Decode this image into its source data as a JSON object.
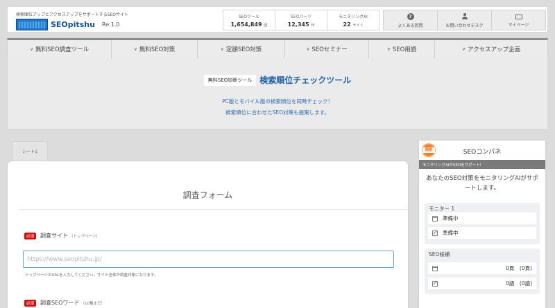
{
  "header": {
    "tagline": "検索順位アップとアクセスアップをサポートするSEOサイト",
    "logo_text": "SEOpitshu",
    "version": "Re:1.0",
    "stats": [
      {
        "label": "SEOツール",
        "value": "1,654,849",
        "unit": "回"
      },
      {
        "label": "SEOパーツ",
        "value": "12,345",
        "unit": "作"
      },
      {
        "label": "モニタリングAI",
        "value": "22",
        "unit": "サイト"
      }
    ],
    "buttons": [
      {
        "icon": "question-icon",
        "label": "よくある質問"
      },
      {
        "icon": "user-icon",
        "label": "お問い合わせデスク"
      },
      {
        "icon": "card-icon",
        "label": "マイページ"
      }
    ]
  },
  "nav": {
    "items": [
      "無料SEO調査ツール",
      "無料SEO対策",
      "定額SEO対策",
      "SEOセミナー",
      "SEO用語",
      "アクセスアップ企画"
    ]
  },
  "hero": {
    "badge": "無料SEO診断ツール",
    "title": "検索順位チェックツール",
    "desc1": "PC版とモバイル版の検索順位を同時チェック！",
    "desc2": "検索順位に合わせたSEO対策も提案します。"
  },
  "form": {
    "tab_label": "シート1",
    "title": "調査フォーム",
    "required_label": "必須",
    "site_label": "調査サイト",
    "site_note": "（トップページ）",
    "site_placeholder": "https://www.seopitshu.jp/",
    "site_help": "トップページのURLを入力してください。サイト全体が調査対象になります。",
    "word_label": "調査SEOワード",
    "word_note": "（10種まで）"
  },
  "side": {
    "badge": "限定",
    "title": "SEOコンパネ",
    "strip": "モニタリングAIがSEOをサポート!",
    "desc": "あなたのSEO対策をモニタリングAIがサポートします。",
    "monitor": {
      "title": "モニター 1",
      "rows": [
        {
          "icon": "calendar-icon",
          "text": "準備中"
        },
        {
          "icon": "edit-icon",
          "text": "準備中"
        }
      ]
    },
    "candidates": {
      "title": "SEO候補",
      "rows": [
        {
          "icon": "calendar-icon",
          "text": "0頁　(0頁)"
        },
        {
          "icon": "edit-icon",
          "text": "0語　(0語)"
        }
      ]
    }
  }
}
